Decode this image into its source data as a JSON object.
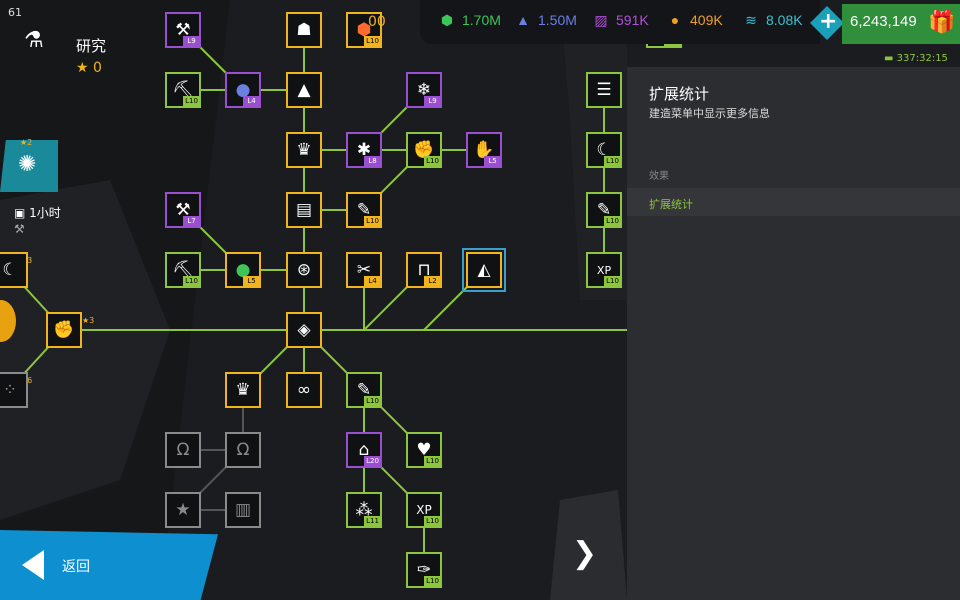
{
  "status": {
    "fps": "61"
  },
  "research": {
    "title": "研究",
    "stars": "0"
  },
  "left_info": {
    "time": "1小时",
    "star_a": "2",
    "star_b": "3",
    "star_c": "3",
    "star_d": "6"
  },
  "top_bar": {
    "partial_value": "00",
    "resources": [
      {
        "icon": "green-hex-icon",
        "value": "1.70M",
        "color": "#3fc45a"
      },
      {
        "icon": "blue-triangle-icon",
        "value": "1.50M",
        "color": "#6a7fe0"
      },
      {
        "icon": "purple-stripe-icon",
        "value": "591K",
        "color": "#b050d8"
      },
      {
        "icon": "orange-ball-icon",
        "value": "409K",
        "color": "#f0a020"
      },
      {
        "icon": "teal-bolt-icon",
        "value": "8.08K",
        "color": "#3bc0d0"
      }
    ],
    "cash": "6,243,149",
    "timer": "337:32:15"
  },
  "tree": {
    "levels": {
      "n1": "L9",
      "n2": "L10",
      "n4": "L10",
      "n5": "L4",
      "n7": "L9",
      "n9": "L8",
      "n10": "L10",
      "n11": "L5",
      "n12": "L7",
      "n14": "L10",
      "n15": "L10",
      "n16": "L5",
      "n18": "L4",
      "n19": "L2",
      "n21": "L10",
      "n22": "L20",
      "n23": "L10",
      "n24": "L11",
      "n25": "L10",
      "n26": "L10"
    }
  },
  "right_column": {
    "levels": {
      "r1": "L10",
      "r2": "L10",
      "r3": "L10",
      "r4": "L10"
    }
  },
  "panel": {
    "title": "扩展统计",
    "subtitle": "建造菜单中显示更多信息",
    "effects_label": "效果",
    "effect_item": "扩展统计"
  },
  "nav": {
    "back_label": "返回"
  },
  "colors": {
    "gold": "#f0b41e",
    "green": "#8cc63f",
    "purple": "#9a4fd0",
    "line": "#8cc63f",
    "panel": "#2c2d30",
    "accent": "#0d8fd0"
  }
}
